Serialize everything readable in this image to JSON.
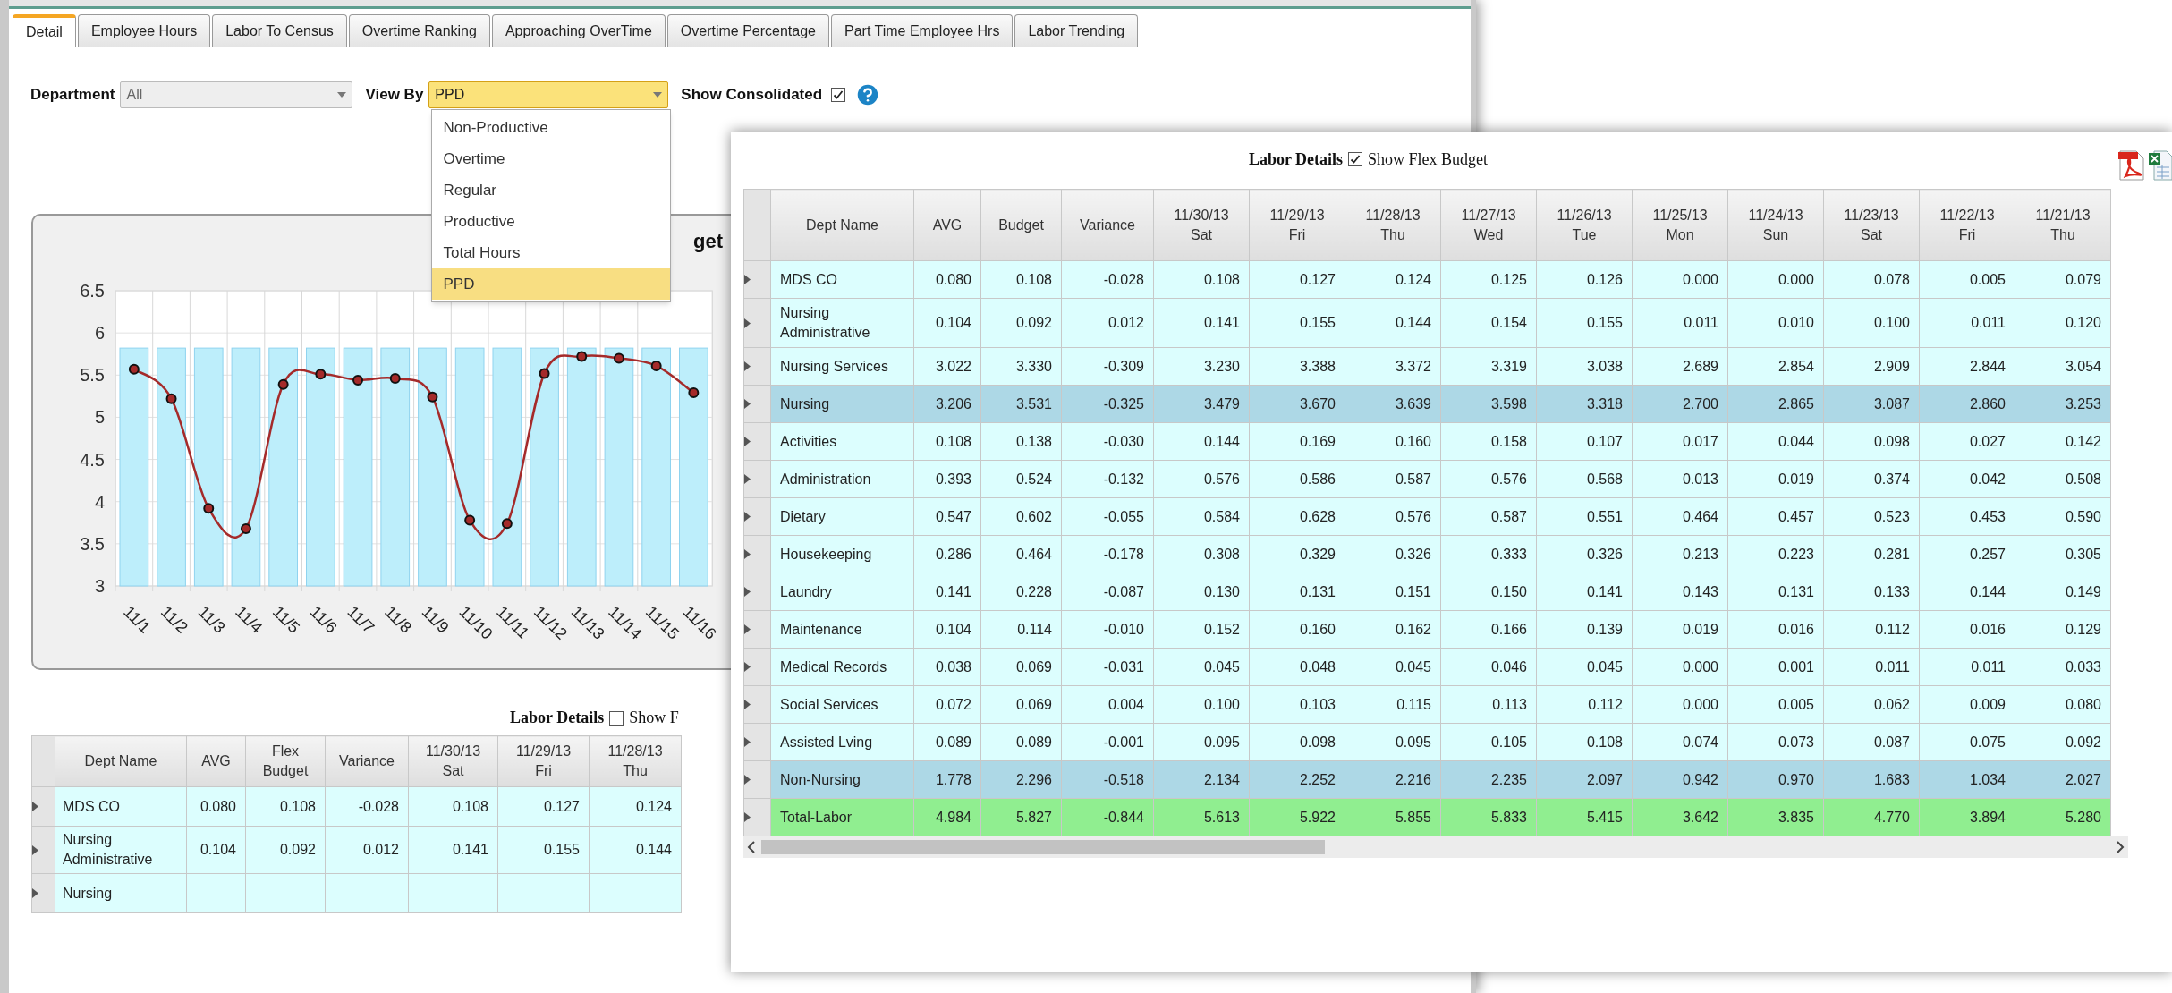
{
  "tabs": [
    {
      "label": "Detail",
      "selected": true
    },
    {
      "label": "Employee Hours",
      "selected": false
    },
    {
      "label": "Labor To Census",
      "selected": false
    },
    {
      "label": "Overtime Ranking",
      "selected": false
    },
    {
      "label": "Approaching OverTime",
      "selected": false
    },
    {
      "label": "Overtime Percentage",
      "selected": false
    },
    {
      "label": "Part Time Employee Hrs",
      "selected": false
    },
    {
      "label": "Labor Trending",
      "selected": false
    }
  ],
  "filters": {
    "department": {
      "label": "Department",
      "value": "All"
    },
    "view_by": {
      "label": "View By",
      "value": "PPD",
      "expanded": true,
      "options": [
        {
          "label": "Non-Productive",
          "selected": false
        },
        {
          "label": "Overtime",
          "selected": false
        },
        {
          "label": "Regular",
          "selected": false
        },
        {
          "label": "Productive",
          "selected": false
        },
        {
          "label": "Total Hours",
          "selected": false
        },
        {
          "label": "PPD",
          "selected": true
        }
      ]
    },
    "show_consolidated": {
      "label": "Show Consolidated",
      "checked": true
    }
  },
  "chart": {
    "title": "get",
    "chart_data": {
      "type": "bar",
      "categories": [
        "11/1",
        "11/2",
        "11/3",
        "11/4",
        "11/5",
        "11/6",
        "11/7",
        "11/8",
        "11/9",
        "11/10",
        "11/11",
        "11/12",
        "11/13",
        "11/14",
        "11/15",
        "11/16"
      ],
      "series": [
        {
          "color": "#bdeefb",
          "values": [
            5.82,
            5.82,
            5.82,
            5.82,
            5.82,
            5.82,
            5.82,
            5.82,
            5.82,
            5.82,
            5.82,
            5.82,
            5.82,
            5.82,
            5.82,
            5.82
          ]
        },
        {
          "type": "line",
          "marker": "circle",
          "color": "#a52a2a",
          "values": [
            5.57,
            5.22,
            3.92,
            3.68,
            5.39,
            5.51,
            5.44,
            5.46,
            5.24,
            3.78,
            3.74,
            5.52,
            5.72,
            5.7,
            5.61,
            5.29
          ]
        }
      ],
      "grid": true,
      "ylim": [
        3,
        6.5
      ],
      "yticks": [
        3,
        3.5,
        4,
        4.5,
        5,
        5.5,
        6,
        6.5
      ]
    }
  },
  "labor_details": {
    "title": "Labor Details",
    "flex_budget": {
      "label": "Show F",
      "checked": false
    },
    "columns": [
      {
        "label": "Dept Name"
      },
      {
        "label": "AVG"
      },
      {
        "label": "Flex Budget"
      },
      {
        "label": "Variance"
      },
      {
        "label": "11/30/13",
        "sub": "Sat"
      },
      {
        "label": "11/29/13",
        "sub": "Fri"
      },
      {
        "label": "11/28/13",
        "sub": "Thu"
      }
    ],
    "rows": [
      {
        "name": "MDS CO",
        "values": [
          "0.080",
          "0.108",
          "-0.028",
          "0.108",
          "0.127",
          "0.124"
        ]
      },
      {
        "name": "Nursing Administrative",
        "values": [
          "0.104",
          "0.092",
          "0.012",
          "0.141",
          "0.155",
          "0.144"
        ]
      },
      {
        "name": "Nursing",
        "values": []
      }
    ]
  },
  "detail_popup": {
    "title": "Labor Details",
    "flex_budget": {
      "label": "Show Flex Budget",
      "checked": true
    },
    "columns": [
      {
        "label": "Dept Name"
      },
      {
        "label": "AVG"
      },
      {
        "label": "Budget"
      },
      {
        "label": "Variance"
      },
      {
        "label": "11/30/13",
        "sub": "Sat"
      },
      {
        "label": "11/29/13",
        "sub": "Fri"
      },
      {
        "label": "11/28/13",
        "sub": "Thu"
      },
      {
        "label": "11/27/13",
        "sub": "Wed"
      },
      {
        "label": "11/26/13",
        "sub": "Tue"
      },
      {
        "label": "11/25/13",
        "sub": "Mon"
      },
      {
        "label": "11/24/13",
        "sub": "Sun"
      },
      {
        "label": "11/23/13",
        "sub": "Sat"
      },
      {
        "label": "11/22/13",
        "sub": "Fri"
      },
      {
        "label": "11/21/13",
        "sub": "Thu"
      }
    ],
    "rows": [
      {
        "kind": "row",
        "name": "MDS CO",
        "values": [
          "0.080",
          "0.108",
          "-0.028",
          "0.108",
          "0.127",
          "0.124",
          "0.125",
          "0.126",
          "0.000",
          "0.000",
          "0.078",
          "0.005",
          "0.079"
        ]
      },
      {
        "kind": "row",
        "name": "Nursing Administrative",
        "values": [
          "0.104",
          "0.092",
          "0.012",
          "0.141",
          "0.155",
          "0.144",
          "0.154",
          "0.155",
          "0.011",
          "0.010",
          "0.100",
          "0.011",
          "0.120"
        ]
      },
      {
        "kind": "row",
        "name": "Nursing Services",
        "values": [
          "3.022",
          "3.330",
          "-0.309",
          "3.230",
          "3.388",
          "3.372",
          "3.319",
          "3.038",
          "2.689",
          "2.854",
          "2.909",
          "2.844",
          "3.054"
        ]
      },
      {
        "kind": "subtotal",
        "name": "Nursing",
        "values": [
          "3.206",
          "3.531",
          "-0.325",
          "3.479",
          "3.670",
          "3.639",
          "3.598",
          "3.318",
          "2.700",
          "2.865",
          "3.087",
          "2.860",
          "3.253"
        ]
      },
      {
        "kind": "row",
        "name": "Activities",
        "values": [
          "0.108",
          "0.138",
          "-0.030",
          "0.144",
          "0.169",
          "0.160",
          "0.158",
          "0.107",
          "0.017",
          "0.044",
          "0.098",
          "0.027",
          "0.142"
        ]
      },
      {
        "kind": "row",
        "name": "Administration",
        "values": [
          "0.393",
          "0.524",
          "-0.132",
          "0.576",
          "0.586",
          "0.587",
          "0.576",
          "0.568",
          "0.013",
          "0.019",
          "0.374",
          "0.042",
          "0.508"
        ]
      },
      {
        "kind": "row",
        "name": "Dietary",
        "values": [
          "0.547",
          "0.602",
          "-0.055",
          "0.584",
          "0.628",
          "0.576",
          "0.587",
          "0.551",
          "0.464",
          "0.457",
          "0.523",
          "0.453",
          "0.590"
        ]
      },
      {
        "kind": "row",
        "name": "Housekeeping",
        "values": [
          "0.286",
          "0.464",
          "-0.178",
          "0.308",
          "0.329",
          "0.326",
          "0.333",
          "0.326",
          "0.213",
          "0.223",
          "0.281",
          "0.257",
          "0.305"
        ]
      },
      {
        "kind": "row",
        "name": "Laundry",
        "values": [
          "0.141",
          "0.228",
          "-0.087",
          "0.130",
          "0.131",
          "0.151",
          "0.150",
          "0.141",
          "0.143",
          "0.131",
          "0.133",
          "0.144",
          "0.149"
        ]
      },
      {
        "kind": "row",
        "name": "Maintenance",
        "values": [
          "0.104",
          "0.114",
          "-0.010",
          "0.152",
          "0.160",
          "0.162",
          "0.166",
          "0.139",
          "0.019",
          "0.016",
          "0.112",
          "0.016",
          "0.129"
        ]
      },
      {
        "kind": "row",
        "name": "Medical Records",
        "values": [
          "0.038",
          "0.069",
          "-0.031",
          "0.045",
          "0.048",
          "0.045",
          "0.046",
          "0.045",
          "0.000",
          "0.001",
          "0.011",
          "0.011",
          "0.033"
        ]
      },
      {
        "kind": "row",
        "name": "Social Services",
        "values": [
          "0.072",
          "0.069",
          "0.004",
          "0.100",
          "0.103",
          "0.115",
          "0.113",
          "0.112",
          "0.000",
          "0.005",
          "0.062",
          "0.009",
          "0.080"
        ]
      },
      {
        "kind": "row",
        "name": "Assisted Lving",
        "values": [
          "0.089",
          "0.089",
          "-0.001",
          "0.095",
          "0.098",
          "0.095",
          "0.105",
          "0.108",
          "0.074",
          "0.073",
          "0.087",
          "0.075",
          "0.092"
        ]
      },
      {
        "kind": "subtotal",
        "name": "Non-Nursing",
        "values": [
          "1.778",
          "2.296",
          "-0.518",
          "2.134",
          "2.252",
          "2.216",
          "2.235",
          "2.097",
          "0.942",
          "0.970",
          "1.683",
          "1.034",
          "2.027"
        ]
      },
      {
        "kind": "total",
        "name": "Total-Labor",
        "values": [
          "4.984",
          "5.827",
          "-0.844",
          "5.613",
          "5.922",
          "5.855",
          "5.833",
          "5.415",
          "3.642",
          "3.835",
          "4.770",
          "3.894",
          "5.280"
        ]
      }
    ]
  }
}
